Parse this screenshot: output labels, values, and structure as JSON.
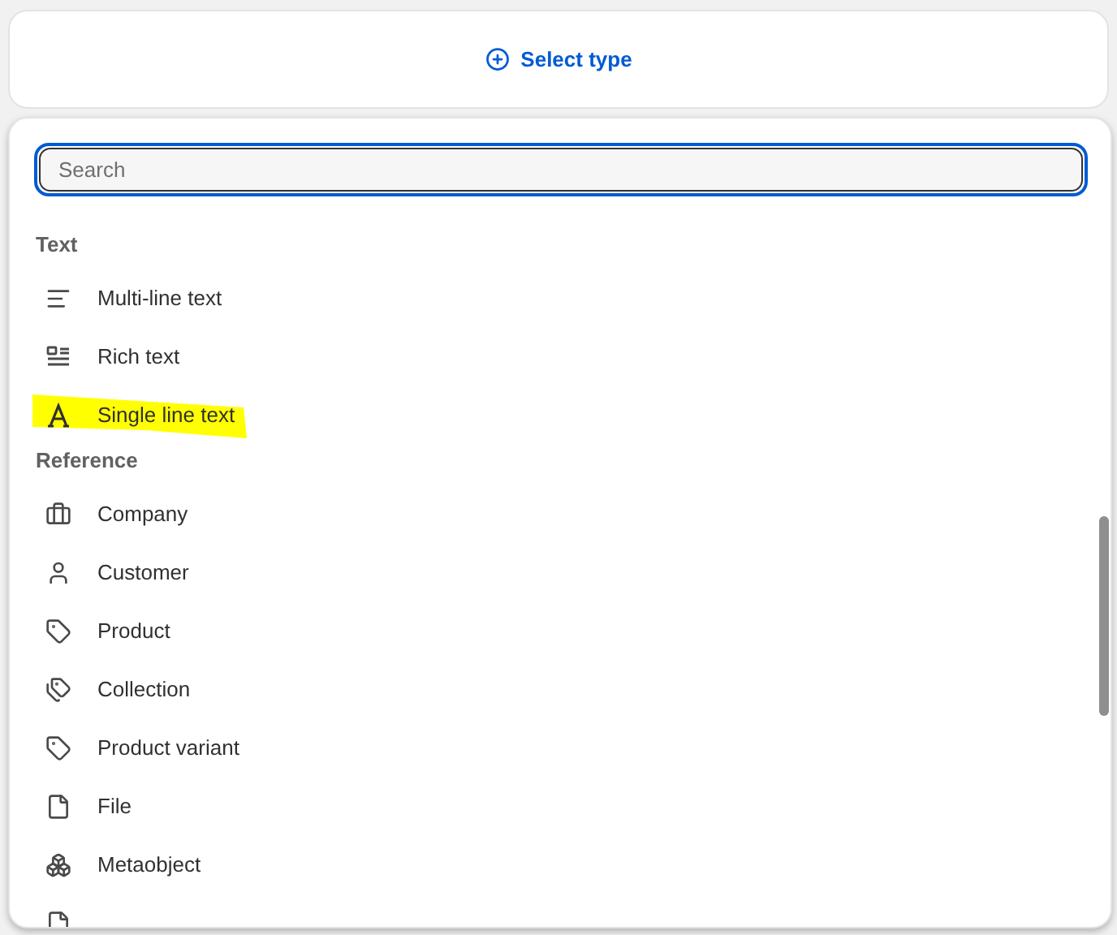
{
  "select_button": {
    "label": "Select type"
  },
  "search": {
    "placeholder": "Search"
  },
  "sections": [
    {
      "title": "Text",
      "items": [
        {
          "label": "Multi-line text",
          "highlighted": false
        },
        {
          "label": "Rich text",
          "highlighted": false
        },
        {
          "label": "Single line text",
          "highlighted": true
        }
      ]
    },
    {
      "title": "Reference",
      "items": [
        {
          "label": "Company",
          "highlighted": false
        },
        {
          "label": "Customer",
          "highlighted": false
        },
        {
          "label": "Product",
          "highlighted": false
        },
        {
          "label": "Collection",
          "highlighted": false
        },
        {
          "label": "Product variant",
          "highlighted": false
        },
        {
          "label": "File",
          "highlighted": false
        },
        {
          "label": "Metaobject",
          "highlighted": false
        }
      ]
    }
  ]
}
